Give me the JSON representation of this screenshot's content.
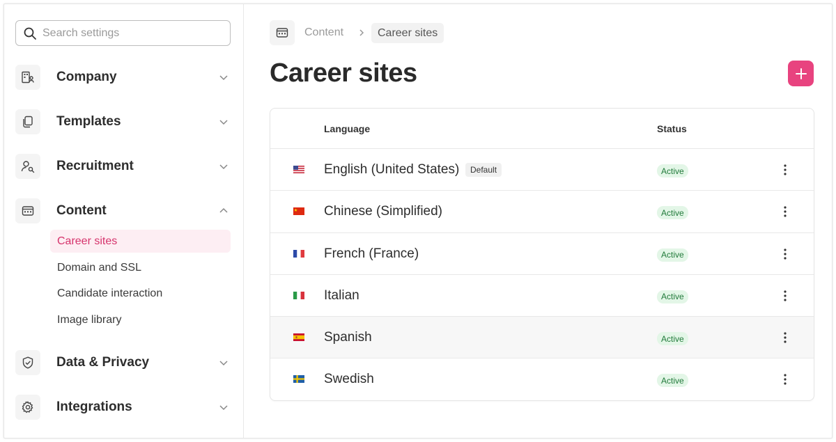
{
  "sidebar": {
    "search_placeholder": "Search settings",
    "sections": [
      {
        "label": "Company",
        "icon": "building-person-icon",
        "expanded": false
      },
      {
        "label": "Templates",
        "icon": "copy-icon",
        "expanded": false
      },
      {
        "label": "Recruitment",
        "icon": "user-search-icon",
        "expanded": false
      },
      {
        "label": "Content",
        "icon": "browser-window-icon",
        "expanded": true
      },
      {
        "label": "Data & Privacy",
        "icon": "shield-check-icon",
        "expanded": false
      },
      {
        "label": "Integrations",
        "icon": "gear-icon",
        "expanded": false
      }
    ],
    "content_items": [
      {
        "label": "Career sites",
        "active": true
      },
      {
        "label": "Domain and SSL",
        "active": false
      },
      {
        "label": "Candidate interaction",
        "active": false
      },
      {
        "label": "Image library",
        "active": false
      }
    ]
  },
  "breadcrumb": {
    "parent": "Content",
    "current": "Career sites"
  },
  "page": {
    "title": "Career sites",
    "add_button_icon": "plus-icon"
  },
  "table": {
    "columns": [
      "Language",
      "Status"
    ],
    "rows": [
      {
        "flag": "us-flag-icon",
        "language": "English (United States)",
        "badge": "Default",
        "status": "Active"
      },
      {
        "flag": "cn-flag-icon",
        "language": "Chinese (Simplified)",
        "badge": "",
        "status": "Active"
      },
      {
        "flag": "fr-flag-icon",
        "language": "French (France)",
        "badge": "",
        "status": "Active"
      },
      {
        "flag": "it-flag-icon",
        "language": "Italian",
        "badge": "",
        "status": "Active"
      },
      {
        "flag": "es-flag-icon",
        "language": "Spanish",
        "badge": "",
        "status": "Active"
      },
      {
        "flag": "se-flag-icon",
        "language": "Swedish",
        "badge": "",
        "status": "Active"
      }
    ]
  },
  "colors": {
    "accent": "#e8437f",
    "active_text": "#d6336c",
    "active_bg": "#fdeef3",
    "status_bg": "#e3f6e7",
    "status_text": "#217a3a"
  }
}
